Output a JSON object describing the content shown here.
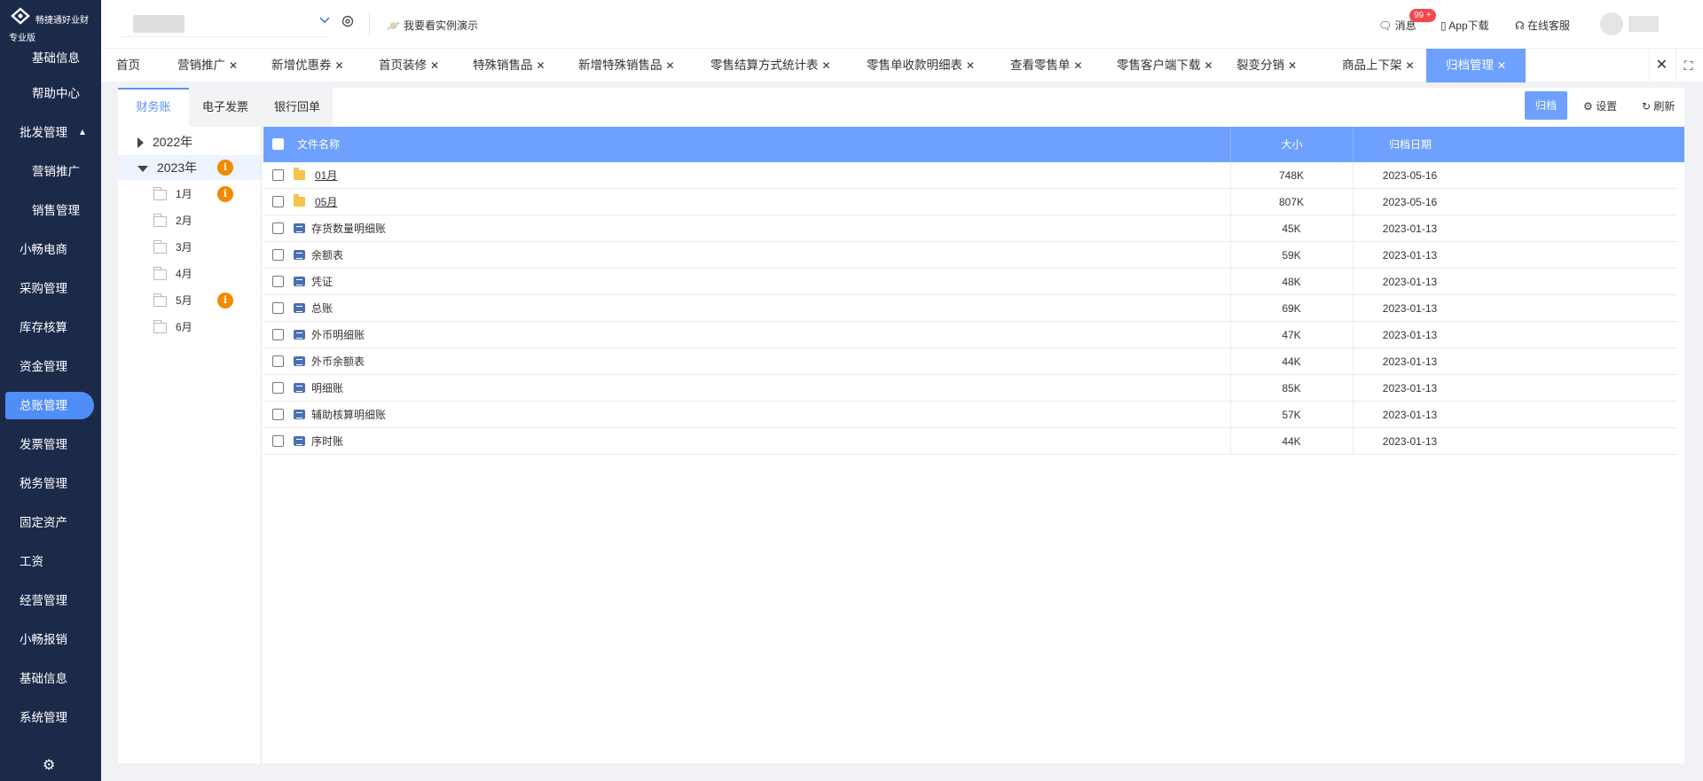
{
  "app": {
    "name": "畅捷通好业财",
    "edition": "专业版"
  },
  "sidebar": {
    "items": [
      {
        "label": "基础信息"
      },
      {
        "label": "帮助中心"
      },
      {
        "label": "批发管理"
      },
      {
        "label": "营销推广"
      },
      {
        "label": "销售管理"
      },
      {
        "label": "小畅电商"
      },
      {
        "label": "采购管理"
      },
      {
        "label": "库存核算"
      },
      {
        "label": "资金管理"
      },
      {
        "label": "总账管理"
      },
      {
        "label": "发票管理"
      },
      {
        "label": "税务管理"
      },
      {
        "label": "固定资产"
      },
      {
        "label": "工资"
      },
      {
        "label": "经营管理"
      },
      {
        "label": "小畅报销"
      },
      {
        "label": "基础信息"
      },
      {
        "label": "系统管理"
      }
    ],
    "active_item": "总账管理"
  },
  "topbar": {
    "demo_label": "我要看实例演示",
    "messages_label": "消息",
    "messages_badge": "99 +",
    "app_download_label": "App下载",
    "online_service_label": "在线客服"
  },
  "tabs": [
    {
      "label": "首页",
      "closable": false
    },
    {
      "label": "营销推广",
      "closable": true
    },
    {
      "label": "新增优惠券",
      "closable": true
    },
    {
      "label": "首页装修",
      "closable": true
    },
    {
      "label": "特殊销售品",
      "closable": true
    },
    {
      "label": "新增特殊销售品",
      "closable": true
    },
    {
      "label": "零售结算方式统计表",
      "closable": true
    },
    {
      "label": "零售单收款明细表",
      "closable": true
    },
    {
      "label": "查看零售单",
      "closable": true
    },
    {
      "label": "零售客户端下载",
      "closable": true
    },
    {
      "label": "裂变分销",
      "closable": true
    },
    {
      "label": "商品上下架",
      "closable": true
    },
    {
      "label": "归档管理",
      "closable": true
    }
  ],
  "active_tab": "归档管理",
  "subtabs": [
    {
      "label": "财务账"
    },
    {
      "label": "电子发票"
    },
    {
      "label": "银行回单"
    }
  ],
  "active_subtab": "财务账",
  "toolbar": {
    "archive_label": "归档",
    "settings_label": "设置",
    "refresh_label": "刷新"
  },
  "tree": {
    "years": [
      {
        "label": "2022年",
        "expanded": false
      },
      {
        "label": "2023年",
        "expanded": true,
        "info": true
      }
    ],
    "months": [
      {
        "label": "1月",
        "info": true
      },
      {
        "label": "2月",
        "info": false
      },
      {
        "label": "3月",
        "info": false
      },
      {
        "label": "4月",
        "info": false
      },
      {
        "label": "5月",
        "info": true
      },
      {
        "label": "6月",
        "info": false
      }
    ]
  },
  "table": {
    "columns": {
      "name": "文件名称",
      "size": "大小",
      "date": "归档日期"
    },
    "rows": [
      {
        "name": "01月",
        "type": "folder",
        "size": "748K",
        "date": "2023-05-16"
      },
      {
        "name": "05月",
        "type": "folder",
        "size": "807K",
        "date": "2023-05-16"
      },
      {
        "name": "存货数量明细账",
        "type": "doc",
        "size": "45K",
        "date": "2023-01-13"
      },
      {
        "name": "余额表",
        "type": "doc",
        "size": "59K",
        "date": "2023-01-13"
      },
      {
        "name": "凭证",
        "type": "doc",
        "size": "48K",
        "date": "2023-01-13"
      },
      {
        "name": "总账",
        "type": "doc",
        "size": "69K",
        "date": "2023-01-13"
      },
      {
        "name": "外币明细账",
        "type": "doc",
        "size": "47K",
        "date": "2023-01-13"
      },
      {
        "name": "外币余额表",
        "type": "doc",
        "size": "44K",
        "date": "2023-01-13"
      },
      {
        "name": "明细账",
        "type": "doc",
        "size": "85K",
        "date": "2023-01-13"
      },
      {
        "name": "辅助核算明细账",
        "type": "doc",
        "size": "57K",
        "date": "2023-01-13"
      },
      {
        "name": "序时账",
        "type": "doc",
        "size": "44K",
        "date": "2023-01-13"
      }
    ]
  },
  "colors": {
    "sidebar_bg": "#1c2a4a",
    "accent": "#6ea0ff",
    "info_badge": "#f08a00",
    "message_badge": "#f5484b"
  }
}
